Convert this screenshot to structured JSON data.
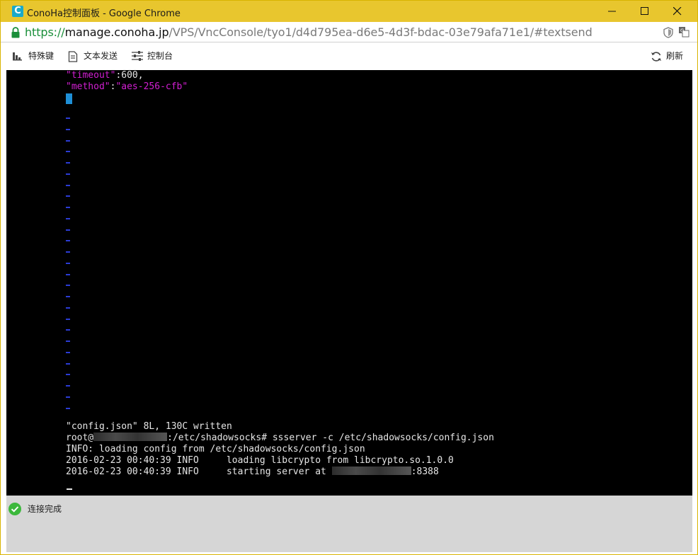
{
  "window": {
    "title": "ConoHa控制面板 - Google Chrome",
    "app_icon_letter": "C",
    "accent_color": "#e8c62e"
  },
  "address": {
    "scheme": "https://",
    "host": "manage.conoha.jp",
    "path": "/VPS/VncConsole/tyo1/d4d795ea-d6e5-4d3f-bdac-03e79afa71e1/#textsend"
  },
  "toolbar": {
    "special_keys": "特殊键",
    "text_send": "文本发送",
    "console": "控制台",
    "refresh": "刷新"
  },
  "terminal": {
    "timeout_key": "\"timeout\"",
    "timeout_value": ":600,",
    "method_key": "\"method\"",
    "method_sep": ":",
    "method_value": "\"aes-256-cfb\"",
    "tilde_rows": 27,
    "written_line": "\"config.json\" 8L, 130C written",
    "prompt_user": "root@",
    "prompt_path": ":/etc/shadowsocks# ssserver -c /etc/shadowsocks/config.json",
    "info_line": "INFO: loading config from /etc/shadowsocks/config.json",
    "log1": "2016-02-23 00:40:39 INFO     loading libcrypto from libcrypto.so.1.0.0",
    "log2_prefix": "2016-02-23 00:40:39 INFO     starting server at ",
    "log2_port": ":8388"
  },
  "status": {
    "message": "连接完成",
    "color": "#3cb83c"
  }
}
